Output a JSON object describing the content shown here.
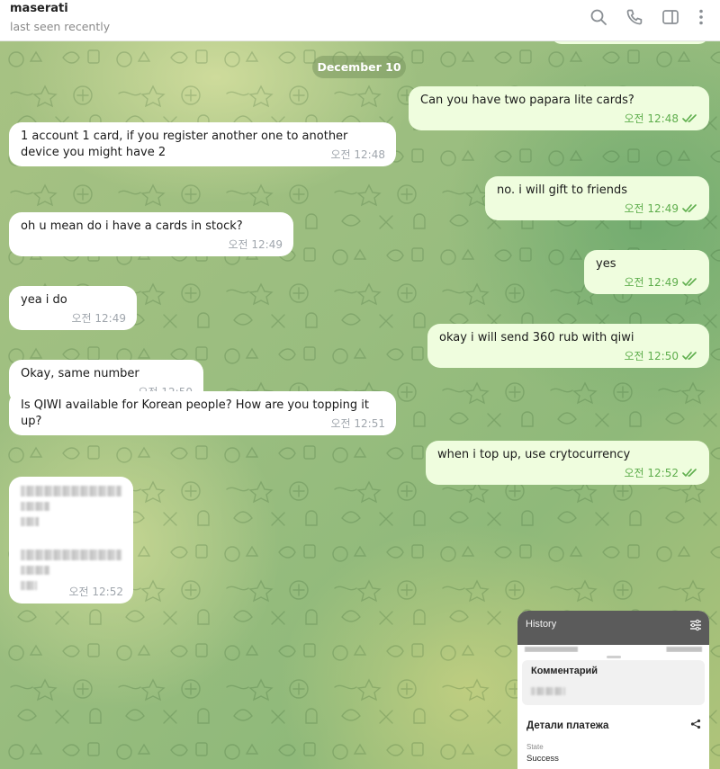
{
  "header": {
    "chat_name": "maserati",
    "status": "last seen recently",
    "icons": [
      "search-icon",
      "phone-icon",
      "sidebar-toggle-icon",
      "more-vertical-icon"
    ]
  },
  "date_separator": "December 10",
  "messages": [
    {
      "dir": "out",
      "text": "Can you have two papara lite cards?",
      "time": "오전 12:48",
      "read": true
    },
    {
      "dir": "in",
      "text": "1 account 1 card, if you register another one to another device you might have 2",
      "time": "오전 12:48"
    },
    {
      "dir": "out",
      "text": "no. i will gift to friends",
      "time": "오전 12:49",
      "read": true
    },
    {
      "dir": "in",
      "text": "oh u mean do i have a cards in stock?",
      "time": "오전 12:49"
    },
    {
      "dir": "out",
      "text": "yes",
      "time": "오전 12:49",
      "read": true
    },
    {
      "dir": "in",
      "text": "yea i do",
      "time": "오전 12:49"
    },
    {
      "dir": "out",
      "text": "okay i will send 360 rub with qiwi",
      "time": "오전 12:50",
      "read": true
    },
    {
      "dir": "in",
      "text": "Okay, same number",
      "time": "오전 12:50"
    },
    {
      "dir": "in",
      "text": "Is QIWI available for Korean people? How are you topping it up?",
      "time": "오전 12:51"
    },
    {
      "dir": "out",
      "text": "when i top up, use crytocurrency",
      "time": "오전 12:52",
      "read": true
    },
    {
      "dir": "in",
      "text": "",
      "redacted": true,
      "time": "오전 12:52"
    }
  ],
  "screenshot_preview": {
    "header_title": "History",
    "card_title": "Комментарий",
    "section_title": "Детали платежа",
    "state_label": "State",
    "state_value": "Success"
  },
  "colors": {
    "incoming_bubble": "#ffffff",
    "outgoing_bubble": "#effdde",
    "outgoing_time": "#5fae4d",
    "incoming_time": "#a0a6ad",
    "wallpaper": "#99bd7f"
  }
}
